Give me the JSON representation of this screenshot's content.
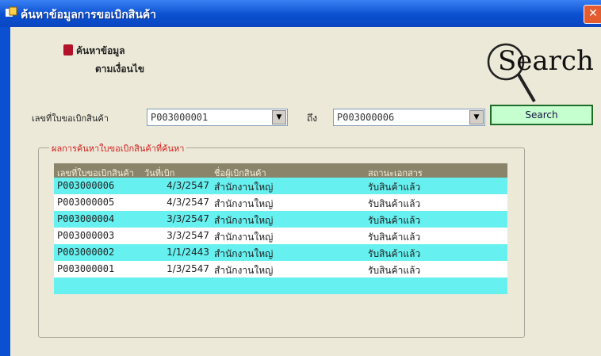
{
  "window": {
    "title": "ค้นหาข้อมูลการขอเบิกสินค้า",
    "close_glyph": "✕"
  },
  "menu": {
    "title": "ค้นหาข้อมูล",
    "subtitle": "ตามเงื่อนไข"
  },
  "logo": {
    "text": "Search"
  },
  "filter": {
    "label": "เลขที่ใบขอเบิกสินค้า",
    "from_value": "P003000001",
    "to_label": "ถึง",
    "to_value": "P003000006",
    "search_button": "Search"
  },
  "results": {
    "group_title": "ผลการค้นหาใบขอเบิกสินค้าที่ค้นหา",
    "columns": [
      "เลขที่ใบขอเบิกสินค้า",
      "วันที่เบิก",
      "ชื่อผู้เบิกสินค้า",
      "สถานะเอกสาร"
    ],
    "rows": [
      {
        "id": "P003000006",
        "date": "4/3/2547",
        "requester": "สำนักงานใหญ่",
        "status": "รับสินค้าแล้ว"
      },
      {
        "id": "P003000005",
        "date": "4/3/2547",
        "requester": "สำนักงานใหญ่",
        "status": "รับสินค้าแล้ว"
      },
      {
        "id": "P003000004",
        "date": "3/3/2547",
        "requester": "สำนักงานใหญ่",
        "status": "รับสินค้าแล้ว"
      },
      {
        "id": "P003000003",
        "date": "3/3/2547",
        "requester": "สำนักงานใหญ่",
        "status": "รับสินค้าแล้ว"
      },
      {
        "id": "P003000002",
        "date": "1/1/2443",
        "requester": "สำนักงานใหญ่",
        "status": "รับสินค้าแล้ว"
      },
      {
        "id": "P003000001",
        "date": "1/3/2547",
        "requester": "สำนักงานใหญ่",
        "status": "รับสินค้าแล้ว"
      }
    ]
  },
  "colors": {
    "row_highlight": "#66f0f0",
    "header_bg": "#8a846a",
    "search_button_bg": "#c6ffcf"
  }
}
